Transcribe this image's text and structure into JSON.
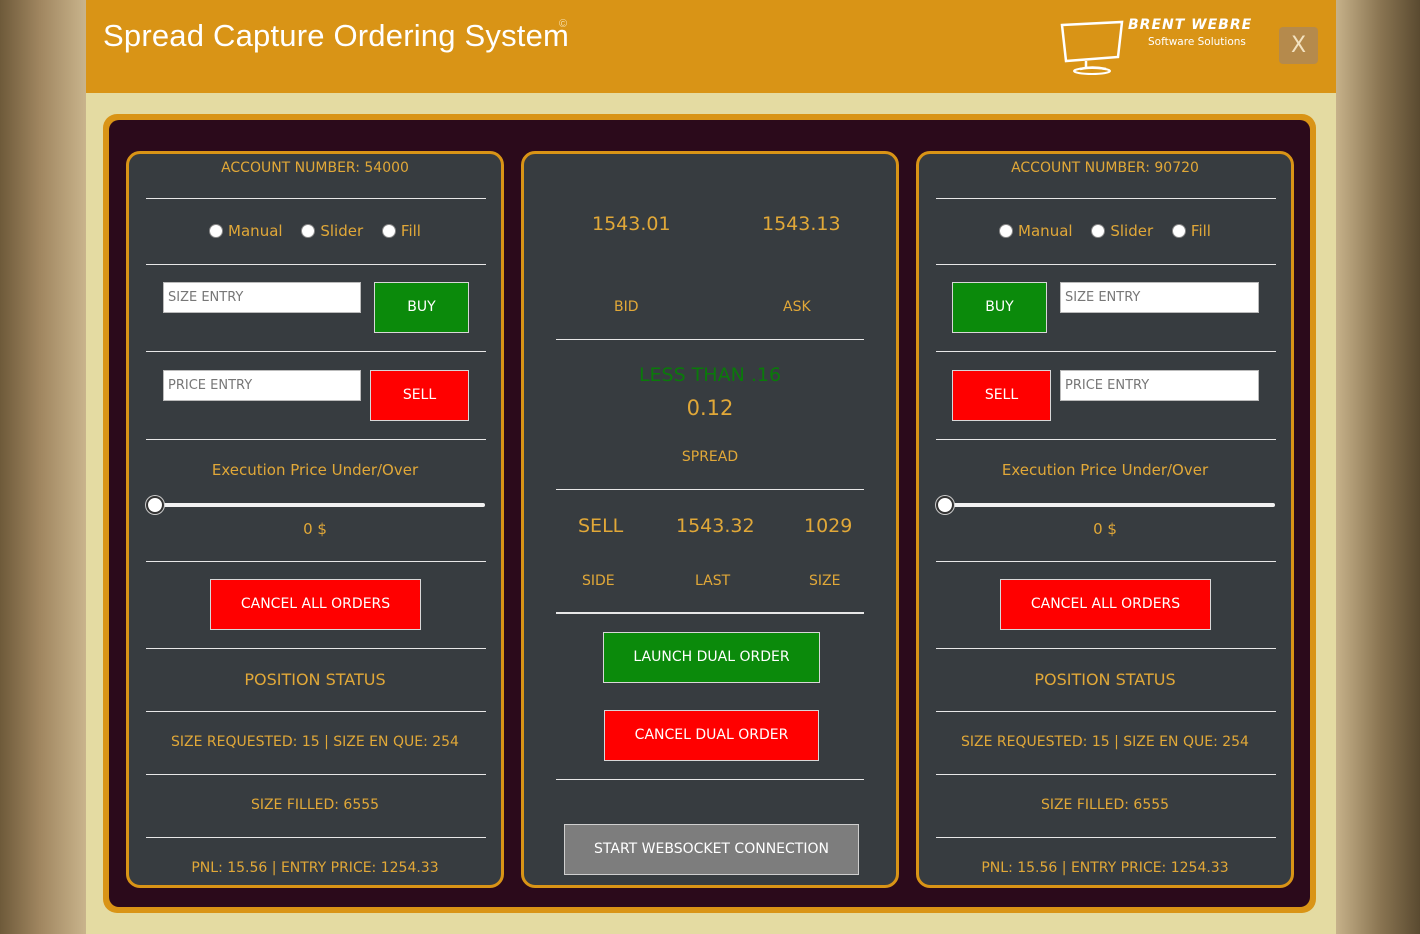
{
  "app": {
    "title": "Spread Capture Ordering System",
    "title_mark": "©",
    "close_label": "X",
    "logo": {
      "name": "BRENT WEBRE",
      "tagline": "Software Solutions"
    }
  },
  "colors": {
    "accent": "#d99416",
    "panel_bg": "#373c40",
    "text_gold": "#e1a838",
    "buy_green": "#0b8a0b",
    "sell_red": "#ff0000",
    "spread_green": "#0a7a0a"
  },
  "left": {
    "account": "ACCOUNT NUMBER: 54000",
    "modes": [
      "Manual",
      "Slider",
      "Fill"
    ],
    "size_placeholder": "SIZE ENTRY",
    "price_placeholder": "PRICE ENTRY",
    "buy_label": "BUY",
    "sell_label": "SELL",
    "slider_title": "Execution Price Under/Over",
    "slider_fraction": 0,
    "slider_value": "0 $",
    "cancel_all_label": "CANCEL ALL ORDERS",
    "position_status": "POSITION STATUS",
    "size_line": "SIZE REQUESTED: 15 | SIZE EN QUE: 254",
    "filled_line": "SIZE FILLED: 6555",
    "pnl_line": "PNL: 15.56 | ENTRY PRICE: 1254.33"
  },
  "middle": {
    "bid_value": "1543.01",
    "ask_value": "1543.13",
    "bid_label": "BID",
    "ask_label": "ASK",
    "spread_condition": "LESS THAN .16",
    "spread_value": "0.12",
    "spread_label": "SPREAD",
    "side_value": "SELL",
    "last_value": "1543.32",
    "size_value": "1029",
    "side_label": "SIDE",
    "last_label": "LAST",
    "size_label": "SIZE",
    "launch_label": "LAUNCH DUAL ORDER",
    "cancel_dual_label": "CANCEL DUAL ORDER",
    "websocket_label": "START WEBSOCKET CONNECTION"
  },
  "right": {
    "account": "ACCOUNT NUMBER: 90720",
    "modes": [
      "Manual",
      "Slider",
      "Fill"
    ],
    "size_placeholder": "SIZE ENTRY",
    "price_placeholder": "PRICE ENTRY",
    "buy_label": "BUY",
    "sell_label": "SELL",
    "slider_title": "Execution Price Under/Over",
    "slider_fraction": 0,
    "slider_value": "0 $",
    "cancel_all_label": "CANCEL ALL ORDERS",
    "position_status": "POSITION STATUS",
    "size_line": "SIZE REQUESTED: 15 | SIZE EN QUE: 254",
    "filled_line": "SIZE FILLED: 6555",
    "pnl_line": "PNL: 15.56 | ENTRY PRICE: 1254.33"
  }
}
